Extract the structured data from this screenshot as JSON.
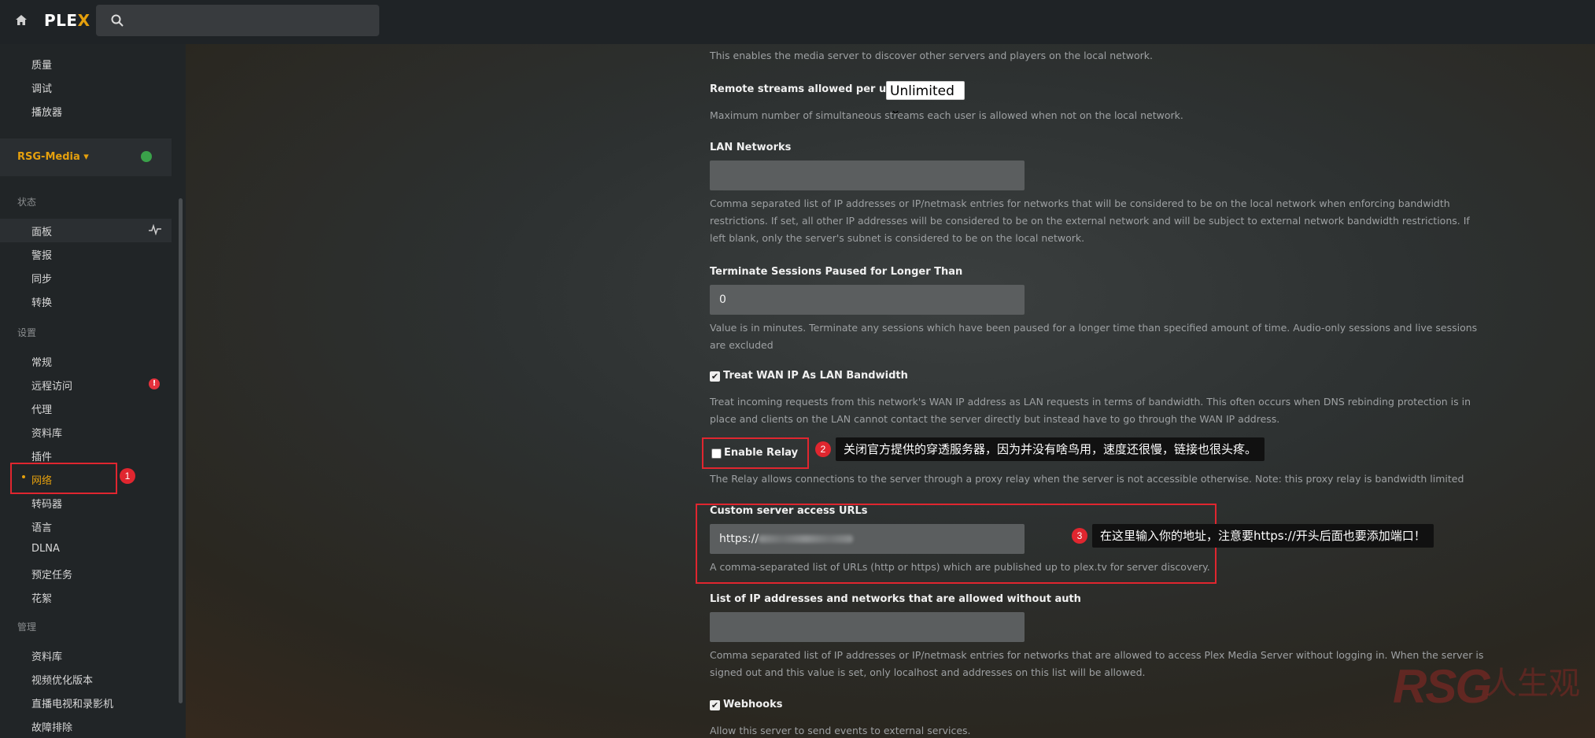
{
  "app": {
    "logo_main": "PLE",
    "logo_x": "X"
  },
  "sidebar": {
    "top_items": [
      "质量",
      "调试",
      "播放器"
    ],
    "server_name": "RSG-Media ▾",
    "sections": {
      "status": "状态",
      "settings": "设置",
      "manage": "管理"
    },
    "status_items": [
      "面板",
      "警报",
      "同步",
      "转换"
    ],
    "settings_items": [
      "常规",
      "远程访问",
      "代理",
      "资料库",
      "插件",
      "网络",
      "转码器",
      "语言",
      "DLNA",
      "预定任务",
      "花絮"
    ],
    "manage_items": [
      "资料库",
      "视频优化版本",
      "直播电视和录影机",
      "故障排除"
    ],
    "active_item": "网络",
    "alert_badge": "!"
  },
  "settings": {
    "discover_desc": "This enables the media server to discover other servers and players on the local network.",
    "remote_streams_label": "Remote streams allowed per user",
    "remote_streams_value": "Unlimited",
    "remote_streams_desc": "Maximum number of simultaneous streams each user is allowed when not on the local network.",
    "lan_label": "LAN Networks",
    "lan_value": "",
    "lan_desc1": "Comma separated list of IP addresses or IP/netmask entries for networks that will be considered to be on the local network when enforcing bandwidth",
    "lan_desc2": "restrictions. If set, all other IP addresses will be considered to be on the external network and will be subject to external network bandwidth restrictions. If",
    "lan_desc3": "left blank, only the server's subnet is considered to be on the local network.",
    "terminate_label": "Terminate Sessions Paused for Longer Than",
    "terminate_value": "0",
    "terminate_desc1": "Value is in minutes. Terminate any sessions which have been paused for a longer time than specified amount of time. Audio-only sessions and live sessions",
    "terminate_desc2": "are excluded",
    "wan_label": "Treat WAN IP As LAN Bandwidth",
    "wan_checked": "✔",
    "wan_desc1": "Treat incoming requests from this network's WAN IP address as LAN requests in terms of bandwidth. This often occurs when DNS rebinding protection is in",
    "wan_desc2": "place and clients on the LAN cannot contact the server directly but instead have to go through the WAN IP address.",
    "relay_label": "Enable Relay",
    "relay_desc": "The Relay allows connections to the server through a proxy relay when the server is not accessible otherwise. Note: this proxy relay is bandwidth limited",
    "custom_url_label": "Custom server access URLs",
    "custom_url_value": "https://",
    "custom_url_desc": "A comma-separated list of URLs (http or https) which are published up to plex.tv for server discovery.",
    "noauth_label": "List of IP addresses and networks that are allowed without auth",
    "noauth_value": "",
    "noauth_desc1": "Comma separated list of IP addresses or IP/netmask entries for networks that are allowed to access Plex Media Server without logging in. When the server is",
    "noauth_desc2": "signed out and this value is set, only localhost and addresses on this list will be allowed.",
    "webhooks_label": "Webhooks",
    "webhooks_checked": "✔",
    "webhooks_desc": "Allow this server to send events to external services."
  },
  "annotations": {
    "badge1": "1",
    "badge2": "2",
    "badge3": "3",
    "callout2": "关闭官方提供的穿透服务器，因为并没有啥鸟用，速度还很慢，链接也很头疼。",
    "callout3": "在这里输入你的地址，注意要https://开头后面也要添加端口！"
  },
  "watermark": {
    "latin": "RSG",
    "cn": "人生观"
  },
  "colors": {
    "accent": "#e5a00d",
    "annotation_red": "#e0262f",
    "topbar": "#1f2326",
    "sidebar": "#212527"
  }
}
